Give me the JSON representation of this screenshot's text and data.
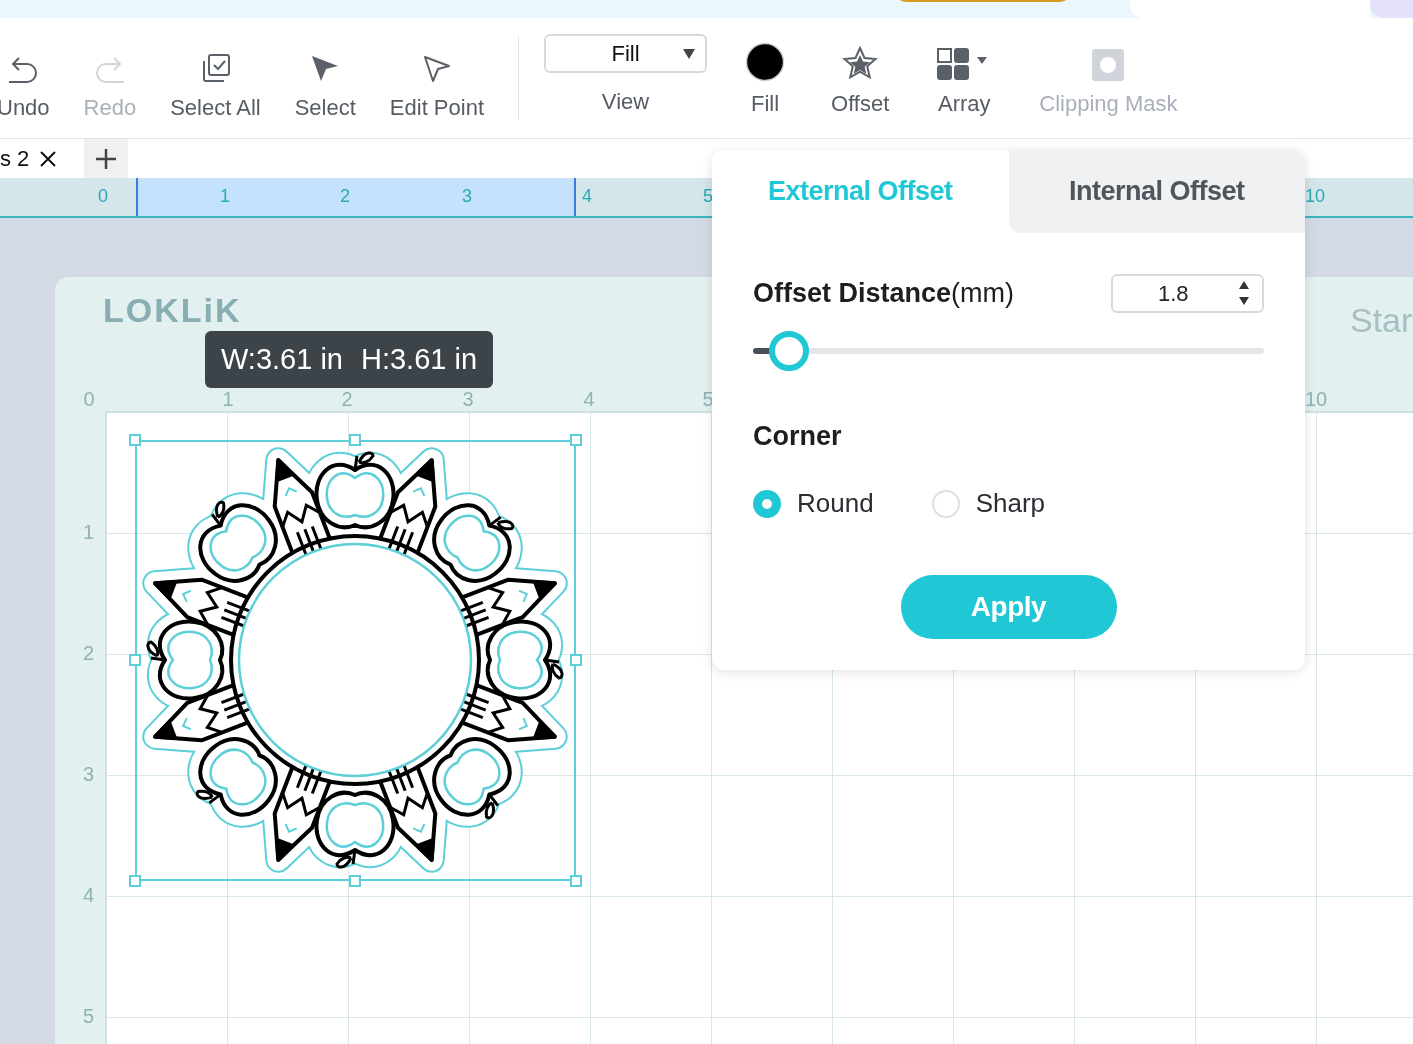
{
  "toolbar": {
    "items": [
      {
        "kind": "undo",
        "label": "Undo",
        "disabled": false
      },
      {
        "kind": "redo",
        "label": "Redo",
        "disabled": true
      },
      {
        "kind": "select_all",
        "label": "Select All",
        "disabled": false
      },
      {
        "kind": "select",
        "label": "Select",
        "disabled": false
      },
      {
        "kind": "edit_point",
        "label": "Edit Point",
        "disabled": false
      }
    ],
    "view": {
      "value": "Fill",
      "label": "View"
    },
    "tools": [
      {
        "kind": "fill",
        "label": "Fill",
        "disabled": false
      },
      {
        "kind": "offset",
        "label": "Offset",
        "disabled": false
      },
      {
        "kind": "array",
        "label": "Array",
        "disabled": false
      },
      {
        "kind": "clip",
        "label": "Clipping Mask",
        "disabled": true
      }
    ]
  },
  "doc_tabs": [
    {
      "label": "s 2",
      "selected": true
    }
  ],
  "ruler": {
    "labels": [
      "0",
      "1",
      "2",
      "3",
      "4",
      "5",
      "10"
    ]
  },
  "mat": {
    "logo": "LOKLiK",
    "corner_text": "Star",
    "top_labels": [
      "0",
      "1",
      "2",
      "3",
      "4",
      "5",
      "10"
    ],
    "side_labels": [
      "1",
      "2",
      "3",
      "4",
      "5"
    ],
    "size_tooltip": {
      "width": "W:3.61 in",
      "height": "H:3.61 in"
    }
  },
  "offset_panel": {
    "tabs": [
      {
        "label": "External Offset",
        "selected": true
      },
      {
        "label": "Internal Offset",
        "selected": false
      }
    ],
    "distance": {
      "label": "**Offset Distance**(mm)",
      "value": "1.8",
      "level": 0.07
    },
    "corner": {
      "label": "Corner",
      "options": [
        {
          "label": "Round",
          "selected": true
        },
        {
          "label": "Sharp",
          "selected": false
        }
      ]
    },
    "apply": "Apply"
  }
}
